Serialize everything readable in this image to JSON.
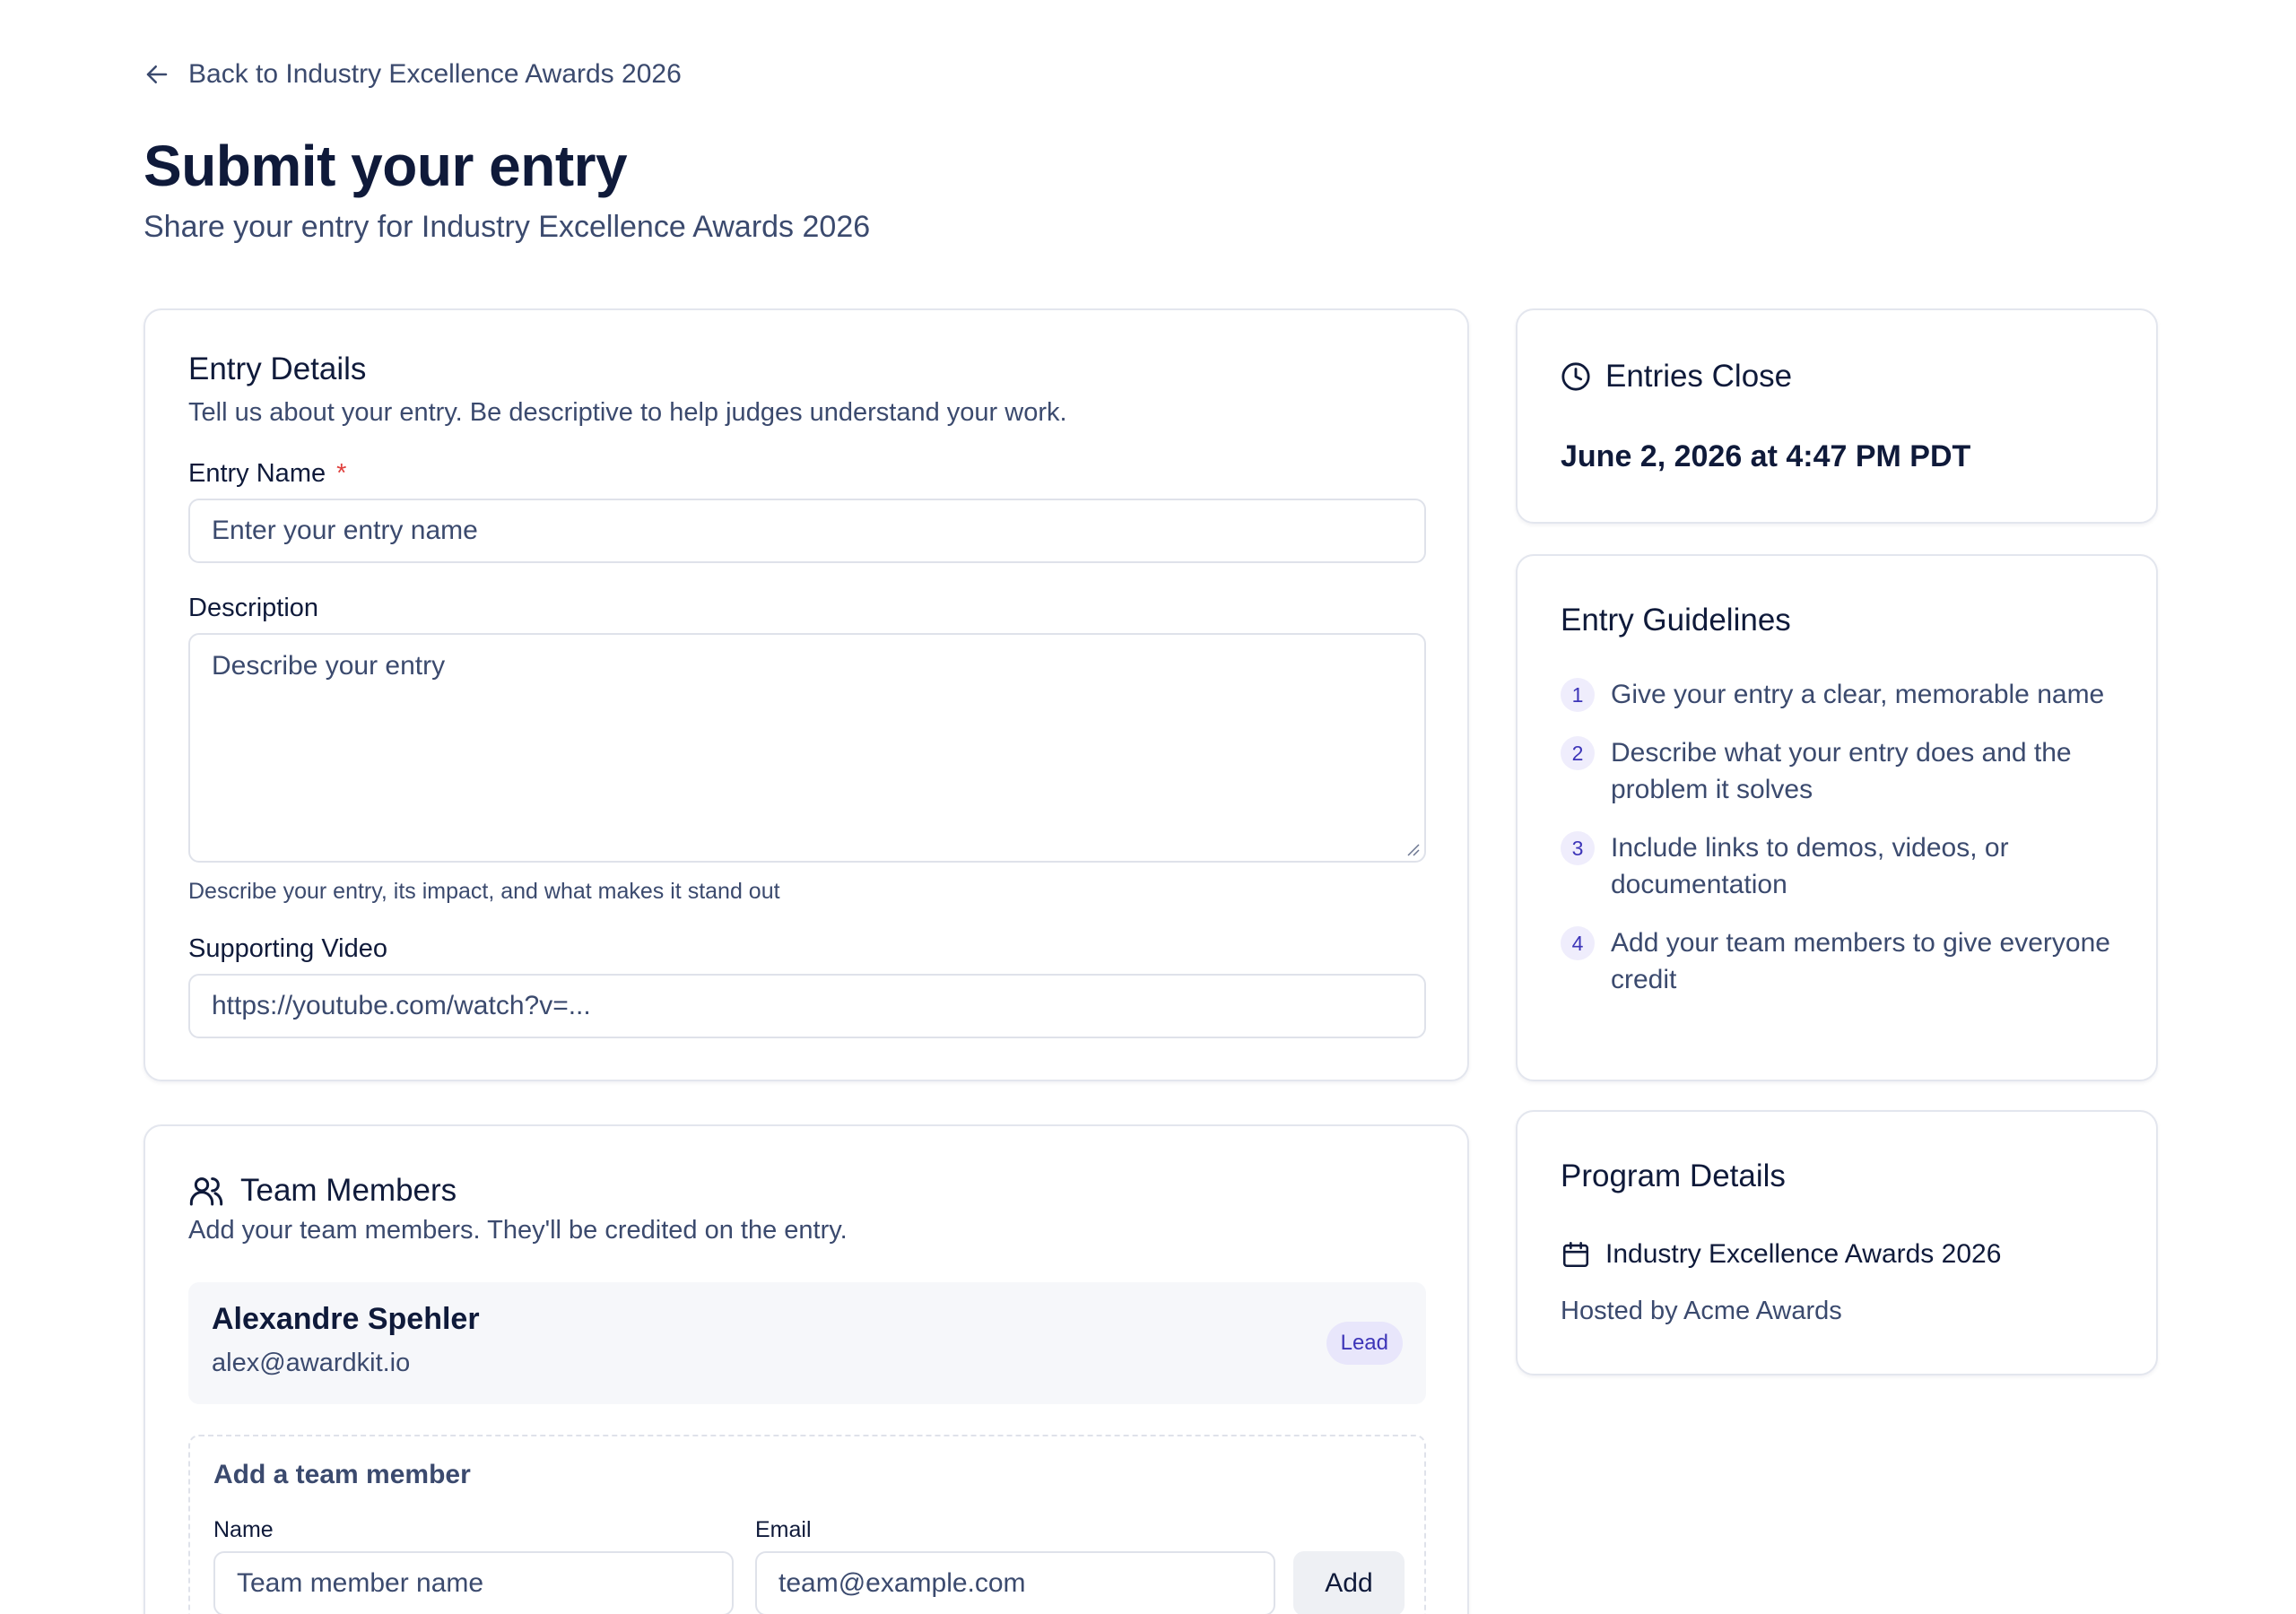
{
  "nav": {
    "back_label": "Back to Industry Excellence Awards 2026"
  },
  "header": {
    "title": "Submit your entry",
    "subtitle": "Share your entry for Industry Excellence Awards 2026"
  },
  "entry_details": {
    "title": "Entry Details",
    "description": "Tell us about your entry. Be descriptive to help judges understand your work.",
    "entry_name": {
      "label": "Entry Name",
      "required_mark": "*",
      "placeholder": "Enter your entry name",
      "value": ""
    },
    "description_field": {
      "label": "Description",
      "placeholder": "Describe your entry",
      "value": "",
      "help": "Describe your entry, its impact, and what makes it stand out"
    },
    "video": {
      "label": "Supporting Video",
      "placeholder": "https://youtube.com/watch?v=...",
      "value": ""
    }
  },
  "team": {
    "title": "Team Members",
    "description": "Add your team members. They'll be credited on the entry.",
    "members": [
      {
        "name": "Alexandre Spehler",
        "email": "alex@awardkit.io",
        "badge": "Lead"
      }
    ],
    "add": {
      "title": "Add a team member",
      "name_label": "Name",
      "name_placeholder": "Team member name",
      "email_label": "Email",
      "email_placeholder": "team@example.com",
      "button": "Add"
    }
  },
  "deadline": {
    "title": "Entries Close",
    "date": "June 2, 2026 at 4:47 PM PDT"
  },
  "guidelines": {
    "title": "Entry Guidelines",
    "items": [
      {
        "num": "1",
        "text": "Give your entry a clear, memorable name"
      },
      {
        "num": "2",
        "text": "Describe what your entry does and the problem it solves"
      },
      {
        "num": "3",
        "text": "Include links to demos, videos, or documentation"
      },
      {
        "num": "4",
        "text": "Add your team members to give everyone credit"
      }
    ]
  },
  "program": {
    "title": "Program Details",
    "name": "Industry Excellence Awards 2026",
    "host": "Hosted by Acme Awards"
  },
  "icons": {
    "back": "arrow-left-icon",
    "team": "users-icon",
    "deadline": "clock-icon",
    "program": "calendar-icon"
  },
  "colors": {
    "text_primary": "#0f1a3a",
    "text_secondary": "#3b4a6e",
    "required": "#e0413e",
    "accent_badge_bg": "#e8e6fb",
    "accent_badge_text": "#3d35b8",
    "border": "#e3e6ee"
  }
}
